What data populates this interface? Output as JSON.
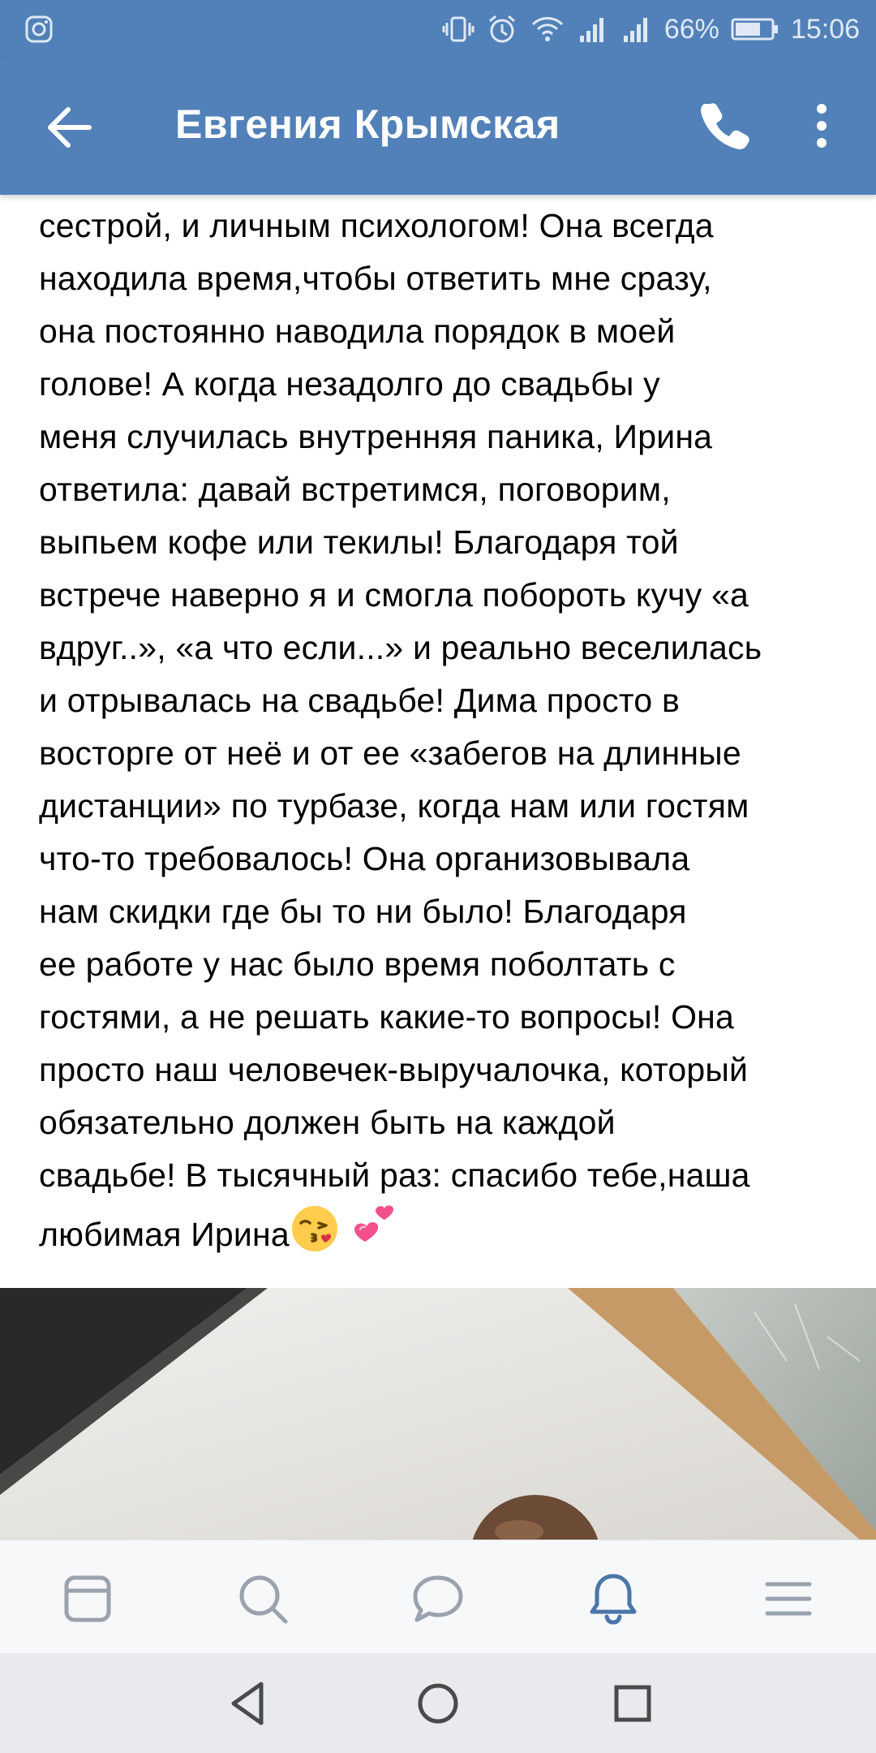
{
  "status_bar": {
    "battery": "66%",
    "time": "15:06",
    "icons": [
      "instagram-icon",
      "vibrate-icon",
      "alarm-icon",
      "wifi-icon",
      "signal-icon",
      "signal-icon-2",
      "battery-icon"
    ]
  },
  "header": {
    "title": "Евгения Крымская",
    "back_icon": "back-arrow-icon",
    "call_icon": "phone-icon",
    "more_icon": "more-vertical-icon"
  },
  "post": {
    "lines": [
      "сестрой, и личным психологом! Она всегда",
      "находила время,чтобы ответить мне сразу,",
      "она постоянно наводила порядок в моей",
      "голове! А когда незадолго до свадьбы у",
      "меня случилась внутренняя паника, Ирина",
      "ответила: давай встретимся, поговорим,",
      "выпьем кофе или текилы! Благодаря той",
      "встрече наверно я и смогла побороть кучу «а",
      "вдруг..», «а что если...» и реально веселилась",
      "и отрывалась на свадьбе! Дима просто в",
      "восторге от неё и от ее «забегов на длинные",
      "дистанции» по турбазе, когда нам или гостям",
      "что-то требовалось! Она организовывала",
      "нам скидки где бы то ни было! Благодаря",
      "ее работе у нас было время поболтать с",
      "гостями, а не решать какие-то вопросы! Она",
      "просто наш человечек-выручалочка, который",
      "обязательно должен быть на каждой",
      "свадьбе! В тысячный раз: спасибо тебе,наша",
      "любимая Ирина"
    ],
    "emojis": [
      "kissing-face-emoji",
      "two-hearts-emoji"
    ]
  },
  "tabbar": {
    "tabs": [
      {
        "name": "news-icon",
        "active": false
      },
      {
        "name": "search-icon",
        "active": false
      },
      {
        "name": "messages-icon",
        "active": false
      },
      {
        "name": "notifications-icon",
        "active": true
      },
      {
        "name": "menu-icon",
        "active": false
      }
    ]
  },
  "navbar": {
    "buttons": [
      "nav-back-icon",
      "nav-home-icon",
      "nav-recents-icon"
    ]
  },
  "colors": {
    "header_bg": "#5181b8",
    "tab_active": "#4a76a8",
    "tab_inactive": "#99a2ad",
    "nav_icon": "#4a4a4a"
  }
}
